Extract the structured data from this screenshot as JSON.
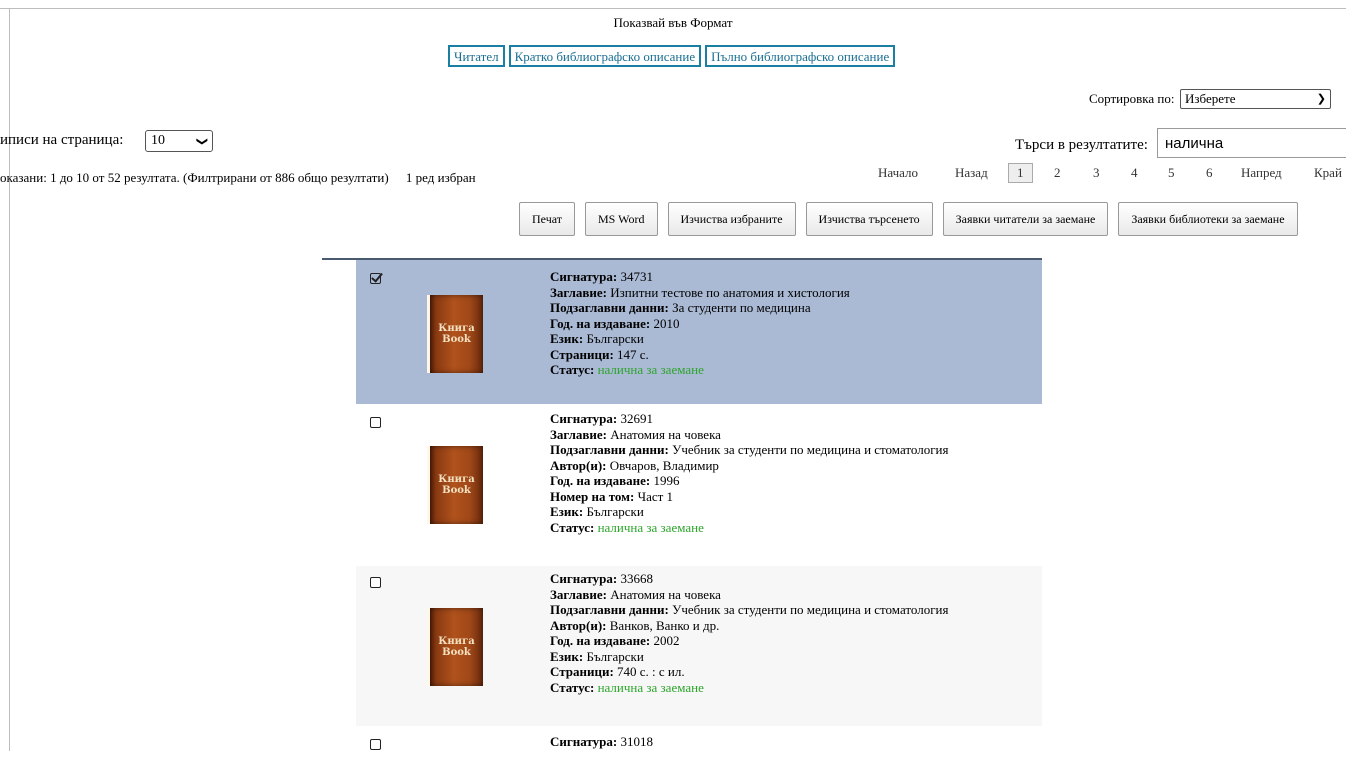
{
  "format": {
    "title": "Показвай във Формат",
    "buttons": [
      "Читател",
      "Кратко библиографско описание",
      "Пълно библиографско описание"
    ]
  },
  "sort": {
    "label": "Сортировка по:",
    "selected": "Изберете"
  },
  "per_page": {
    "label": "иписи на страница:",
    "selected": "10"
  },
  "search": {
    "label": "Търси в резултатите:",
    "value": "налична"
  },
  "info": {
    "text": "оказани: 1 до 10 от 52 резултата. (Филтрирани от 886 общо резултати)",
    "selected": "1 ред избран"
  },
  "pager": {
    "first": "Начало",
    "prev": "Назад",
    "pages": [
      "1",
      "2",
      "3",
      "4",
      "5",
      "6"
    ],
    "current": "1",
    "next": "Напред",
    "last": "Край"
  },
  "actions": [
    "Печат",
    "MS Word",
    "Изчиства избраните",
    "Изчиства търсенето",
    "Заявки читатели за заемане",
    "Заявки библиотеки за заемане"
  ],
  "book_cover": {
    "line1": "Книга",
    "line2": "Book"
  },
  "results": [
    {
      "checked": true,
      "fields": [
        {
          "k": "Сигнатура:",
          "v": "34731"
        },
        {
          "k": "Заглавие:",
          "v": "Изпитни тестове по анатомия и хистология"
        },
        {
          "k": "Подзаглавни данни:",
          "v": "За студенти по медицина"
        },
        {
          "k": "Год. на издаване:",
          "v": "2010"
        },
        {
          "k": "Език:",
          "v": "Български"
        },
        {
          "k": "Страници:",
          "v": "147 с."
        },
        {
          "k": "Статус:",
          "v": "налична за заемане",
          "status": true
        }
      ]
    },
    {
      "checked": false,
      "fields": [
        {
          "k": "Сигнатура:",
          "v": "32691"
        },
        {
          "k": "Заглавие:",
          "v": "Анатомия на човека"
        },
        {
          "k": "Подзаглавни данни:",
          "v": "Учебник за студенти по медицина и стоматология"
        },
        {
          "k": "Автор(и):",
          "v": "Овчаров, Владимир"
        },
        {
          "k": "Год. на издаване:",
          "v": "1996"
        },
        {
          "k": "Номер на том:",
          "v": "Част 1"
        },
        {
          "k": "Език:",
          "v": "Български"
        },
        {
          "k": "Статус:",
          "v": "налична за заемане",
          "status": true
        }
      ]
    },
    {
      "checked": false,
      "fields": [
        {
          "k": "Сигнатура:",
          "v": "33668"
        },
        {
          "k": "Заглавие:",
          "v": "Анатомия на човека"
        },
        {
          "k": "Подзаглавни данни:",
          "v": "Учебник за студенти по медицина и стоматология"
        },
        {
          "k": "Автор(и):",
          "v": "Ванков, Ванко и др."
        },
        {
          "k": "Год. на издаване:",
          "v": "2002"
        },
        {
          "k": "Език:",
          "v": "Български"
        },
        {
          "k": "Страници:",
          "v": "740 с. : с ил."
        },
        {
          "k": "Статус:",
          "v": "налична за заемане",
          "status": true
        }
      ]
    },
    {
      "checked": false,
      "fields": [
        {
          "k": "Сигнатура:",
          "v": "31018"
        }
      ]
    }
  ],
  "colors": {
    "link_border": "#1a7fa3",
    "selected_row": "#aab9d4",
    "status_green": "#2ca52c"
  }
}
